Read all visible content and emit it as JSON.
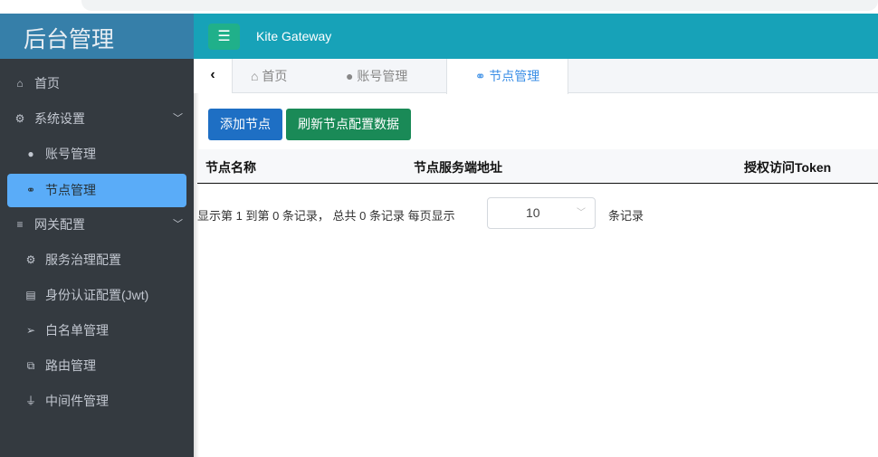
{
  "app": {
    "title": "后台管理",
    "brand": "Kite Gateway"
  },
  "sidebar": {
    "items": [
      {
        "label": "首页",
        "icon": "home-icon"
      },
      {
        "label": "系统设置",
        "icon": "gear-icon"
      },
      {
        "label": "账号管理",
        "icon": "user-icon"
      },
      {
        "label": "节点管理",
        "icon": "link-icon",
        "active": true
      },
      {
        "label": "网关配置",
        "icon": "database-icon"
      },
      {
        "label": "服务治理配置",
        "icon": "cogs-icon"
      },
      {
        "label": "身份认证配置(Jwt)",
        "icon": "id-card-icon"
      },
      {
        "label": "白名单管理",
        "icon": "paper-plane-icon"
      },
      {
        "label": "路由管理",
        "icon": "external-link-icon"
      },
      {
        "label": "中间件管理",
        "icon": "plug-icon"
      }
    ]
  },
  "tabs": [
    {
      "label": "首页"
    },
    {
      "label": "账号管理"
    },
    {
      "label": "节点管理",
      "active": true
    }
  ],
  "toolbar": {
    "add": "添加节点",
    "refresh": "刷新节点配置数据"
  },
  "table": {
    "columns": [
      "节点名称",
      "节点服务端地址",
      "授权访问Token"
    ],
    "rows": []
  },
  "pager": {
    "info": "显示第 1 到第 0 条记录， 总共 0 条记录 每页显示",
    "page_size": "10",
    "suffix": "条记录"
  },
  "colors": {
    "sidebar": "#343a40",
    "header": "#17a2b8",
    "logo": "#367fa9",
    "active": "#5aacf8",
    "primary": "#1e6fc4",
    "success": "#1a8a57"
  }
}
